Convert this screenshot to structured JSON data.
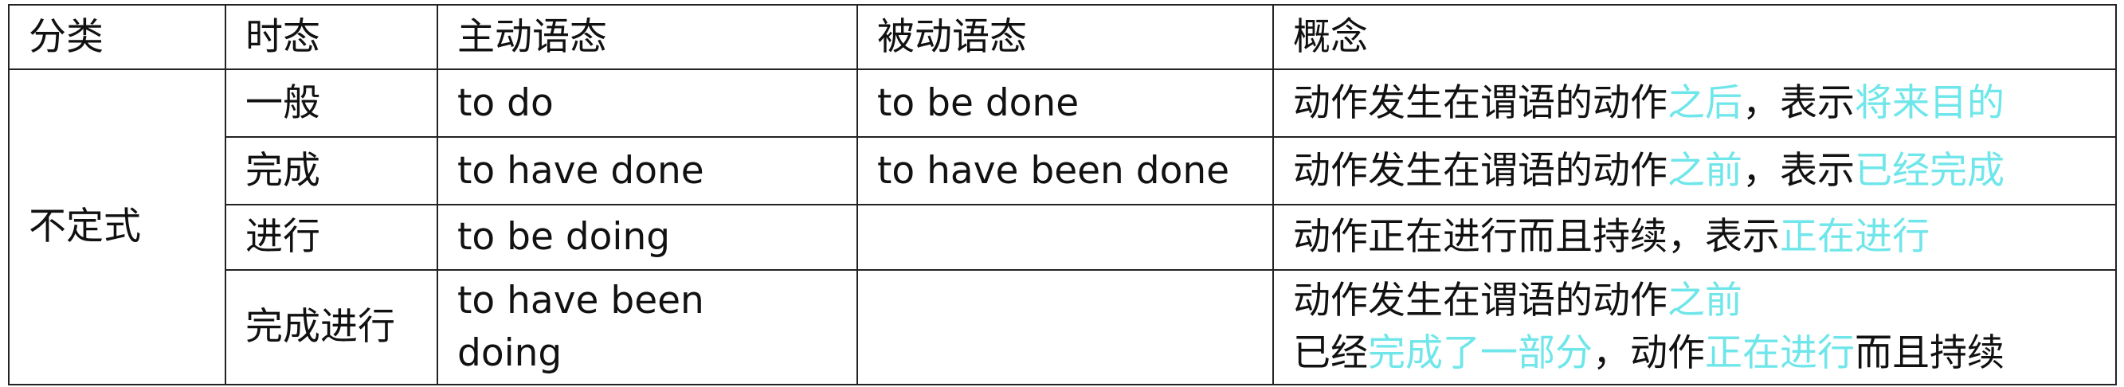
{
  "headers": [
    "分类",
    "时态",
    "主动语态",
    "被动语态",
    "概念"
  ],
  "category": "不定式",
  "rows": [
    {
      "tense": "一般",
      "active": "to do",
      "passive": "to be done",
      "concept": [
        {
          "text": "动作发生在谓语的动作",
          "hl": false
        },
        {
          "text": "之后",
          "hl": true
        },
        {
          "text": "，表示",
          "hl": false
        },
        {
          "text": "将来目的",
          "hl": true
        }
      ]
    },
    {
      "tense": "完成",
      "active": "to have done",
      "passive": "to have been done",
      "concept": [
        {
          "text": "动作发生在谓语的动作",
          "hl": false
        },
        {
          "text": "之前",
          "hl": true
        },
        {
          "text": "，表示",
          "hl": false
        },
        {
          "text": "已经完成",
          "hl": true
        }
      ]
    },
    {
      "tense": "进行",
      "active": "to be doing",
      "passive": "",
      "concept": [
        {
          "text": "动作正在进行而且持续，表示",
          "hl": false
        },
        {
          "text": "正在进行",
          "hl": true
        }
      ]
    },
    {
      "tense": "完成进行",
      "active_lines": [
        "to have been",
        "doing"
      ],
      "passive": "",
      "concept_line1": [
        {
          "text": "动作发生在谓语的动作",
          "hl": false
        },
        {
          "text": "之前",
          "hl": true
        }
      ],
      "concept_line2": [
        {
          "text": "已经",
          "hl": false
        },
        {
          "text": "完成了一部分",
          "hl": true
        },
        {
          "text": "，动作",
          "hl": false
        },
        {
          "text": "正在进行",
          "hl": true
        },
        {
          "text": "而且持续",
          "hl": false
        }
      ]
    }
  ],
  "colors": {
    "highlight": "#6fe6ea",
    "text": "#111111",
    "border": "#222222"
  }
}
